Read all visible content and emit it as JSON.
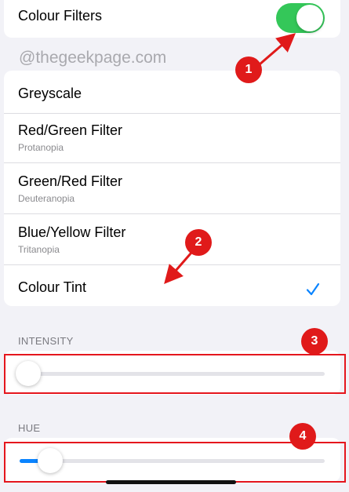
{
  "toggle": {
    "label": "Colour Filters",
    "on": true,
    "on_color": "#34c759"
  },
  "watermark": "@thegeekpage.com",
  "filters": [
    {
      "title": "Greyscale",
      "subtitle": ""
    },
    {
      "title": "Red/Green Filter",
      "subtitle": "Protanopia"
    },
    {
      "title": "Green/Red Filter",
      "subtitle": "Deuteranopia"
    },
    {
      "title": "Blue/Yellow Filter",
      "subtitle": "Tritanopia"
    },
    {
      "title": "Colour Tint",
      "subtitle": "",
      "selected": true
    }
  ],
  "intensity": {
    "label": "INTENSITY",
    "value": 0.0
  },
  "hue": {
    "label": "HUE",
    "value": 0.1,
    "fill_color": "#0a84ff"
  },
  "annotations": {
    "badge1": "1",
    "badge2": "2",
    "badge3": "3",
    "badge4": "4",
    "color": "#e01a1a"
  }
}
